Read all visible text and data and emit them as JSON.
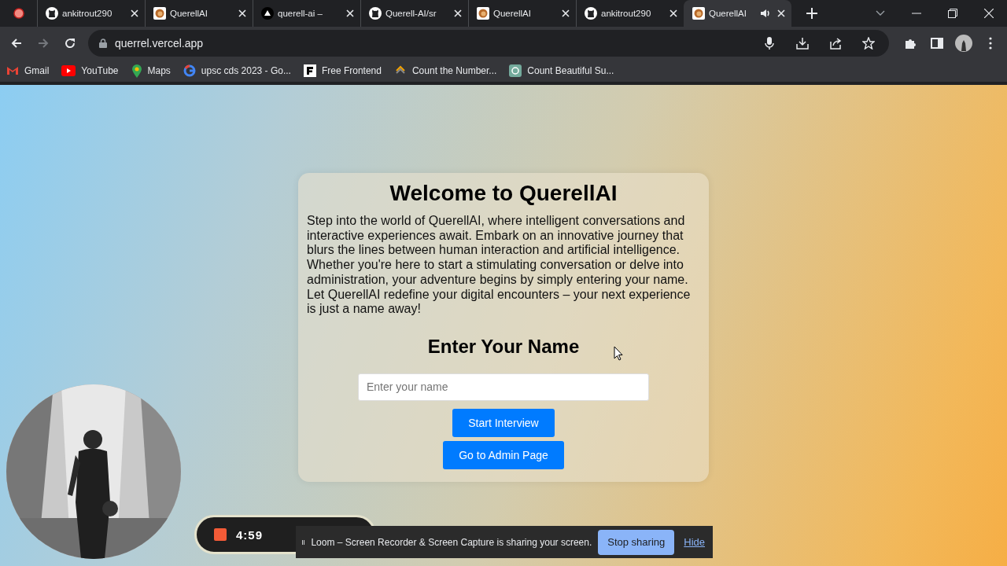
{
  "tabs": [
    {
      "kind": "github",
      "title": "ankitrout290",
      "selected": false,
      "audio": false
    },
    {
      "kind": "querell",
      "title": "QuerellAI",
      "selected": false,
      "audio": false
    },
    {
      "kind": "triangle",
      "title": "querell-ai –",
      "selected": false,
      "audio": false
    },
    {
      "kind": "github",
      "title": "Querell-AI/sr",
      "selected": false,
      "audio": false
    },
    {
      "kind": "querell",
      "title": "QuerellAI",
      "selected": false,
      "audio": false
    },
    {
      "kind": "github",
      "title": "ankitrout290",
      "selected": false,
      "audio": false
    },
    {
      "kind": "querell",
      "title": "QuerellAI",
      "selected": true,
      "audio": true
    }
  ],
  "address": "querrel.vercel.app",
  "bookmarks": [
    {
      "kind": "gmail",
      "label": "Gmail"
    },
    {
      "kind": "youtube",
      "label": "YouTube"
    },
    {
      "kind": "maps",
      "label": "Maps"
    },
    {
      "kind": "google",
      "label": "upsc cds 2023 - Go..."
    },
    {
      "kind": "frontend",
      "label": "Free Frontend"
    },
    {
      "kind": "counter",
      "label": "Count the Number..."
    },
    {
      "kind": "chat",
      "label": "Count Beautiful Su..."
    }
  ],
  "card": {
    "title": "Welcome to QuerellAI",
    "intro": "Step into the world of QuerellAI, where intelligent conversations and interactive experiences await. Embark on an innovative journey that blurs the lines between human interaction and artificial intelligence. Whether you're here to start a stimulating conversation or delve into administration, your adventure begins by simply entering your name. Let QuerellAI redefine your digital encounters – your next experience is just a name away!",
    "name_heading": "Enter Your Name",
    "name_placeholder": "Enter your name",
    "buttons": [
      "Start Interview",
      "Go to Admin Page"
    ]
  },
  "recorder": {
    "time": "4:59"
  },
  "share_bar": {
    "message": "Loom – Screen Recorder & Screen Capture is sharing your screen.",
    "stop_button": "Stop sharing",
    "hide_link": "Hide"
  }
}
